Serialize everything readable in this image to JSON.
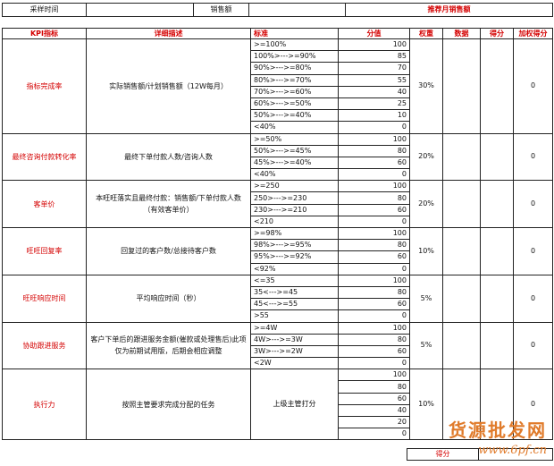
{
  "header": {
    "time_label": "采样时间",
    "sales_label": "销售额",
    "sales_title": "推荐月销售额"
  },
  "table": {
    "columns": [
      "KPI指标",
      "详细描述",
      "标准",
      "分值",
      "权重",
      "数据",
      "得分",
      "加权得分"
    ],
    "sections": [
      {
        "kpi": "指标完成率",
        "desc": "实际销售额/计划销售额（12W每月）",
        "desc_red": false,
        "weight": "30%",
        "weighted": "0",
        "rows": [
          {
            "std": ">=100%",
            "score": "100"
          },
          {
            "std": "100%>--->=90%",
            "score": "85"
          },
          {
            "std": "90%>--->=80%",
            "score": "70"
          },
          {
            "std": "80%>--->=70%",
            "score": "55"
          },
          {
            "std": "70%>--->=60%",
            "score": "40"
          },
          {
            "std": "60%>--->=50%",
            "score": "25"
          },
          {
            "std": "50%>--->=40%",
            "score": "10"
          },
          {
            "std": "<40%",
            "score": "0"
          }
        ]
      },
      {
        "kpi": "最终咨询付款转化率",
        "desc": "最终下单付款人数/咨询人数",
        "desc_red": false,
        "weight": "20%",
        "weighted": "0",
        "rows": [
          {
            "std": ">=50%",
            "score": "100"
          },
          {
            "std": "50%>--->=45%",
            "score": "80"
          },
          {
            "std": "45%>--->=40%",
            "score": "60"
          },
          {
            "std": "<40%",
            "score": "0"
          }
        ]
      },
      {
        "kpi": "客单价",
        "desc": "本旺旺落实且最终付款：销售额/下单付款人数（有效客单价）",
        "desc_red": false,
        "weight": "20%",
        "weighted": "0",
        "rows": [
          {
            "std": ">=250",
            "score": "100"
          },
          {
            "std": "250>--->=230",
            "score": "80"
          },
          {
            "std": "230>--->=210",
            "score": "60"
          },
          {
            "std": "<210",
            "score": "0"
          }
        ]
      },
      {
        "kpi": "旺旺回复率",
        "desc": "回复过的客户数/总接待客户数",
        "desc_red": false,
        "weight": "10%",
        "weighted": "0",
        "rows": [
          {
            "std": ">=98%",
            "score": "100"
          },
          {
            "std": "98%>--->=95%",
            "score": "80"
          },
          {
            "std": "95%>--->=92%",
            "score": "60"
          },
          {
            "std": "<92%",
            "score": "0"
          }
        ]
      },
      {
        "kpi": "旺旺响应时间",
        "desc": "平均响应时间（秒）",
        "desc_red": false,
        "weight": "5%",
        "weighted": "0",
        "rows": [
          {
            "std": "<=35",
            "score": "100"
          },
          {
            "std": "35<--->=45",
            "score": "80"
          },
          {
            "std": "45<--->=55",
            "score": "60"
          },
          {
            "std": ">55",
            "score": "0"
          }
        ]
      },
      {
        "kpi": "协助跟进服务",
        "desc": "客户下单后的跟进服务金额(催款或处理售后)此项仅为前期试用版，后期会相应调整",
        "desc_red": false,
        "weight": "5%",
        "weighted": "0",
        "rows": [
          {
            "std": ">=4W",
            "score": "100"
          },
          {
            "std": "4W>--->=3W",
            "score": "80"
          },
          {
            "std": "3W>--->=2W",
            "score": "60"
          },
          {
            "std": "<2W",
            "score": "0"
          }
        ]
      },
      {
        "kpi": "执行力",
        "desc": "按照主管要求完成分配的任务",
        "desc_red": false,
        "std_merged": "上级主管打分",
        "weight": "10%",
        "weighted": "0",
        "rows": [
          {
            "std": "",
            "score": "100"
          },
          {
            "std": "",
            "score": "80"
          },
          {
            "std": "",
            "score": "60"
          },
          {
            "std": "",
            "score": "40"
          },
          {
            "std": "",
            "score": "20"
          },
          {
            "std": "",
            "score": "0"
          }
        ]
      }
    ],
    "total_label": "得分"
  },
  "watermark": {
    "cn": "货源批发网",
    "url": "www.6pf.cn"
  }
}
